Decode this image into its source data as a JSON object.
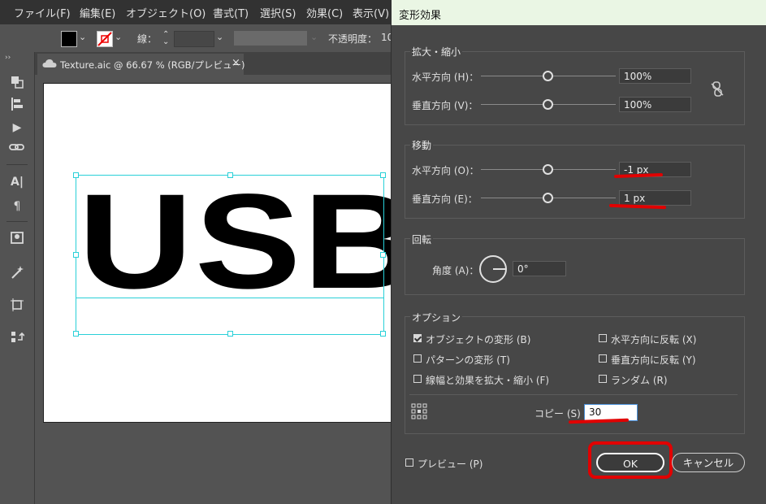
{
  "menubar": {
    "items": [
      "ファイル(F)",
      "編集(E)",
      "オブジェクト(O)",
      "書式(T)",
      "選択(S)",
      "効果(C)",
      "表示(V)"
    ]
  },
  "controlbar": {
    "stroke_label": "線：",
    "opacity_label": "不透明度：",
    "opacity_value": "10"
  },
  "document": {
    "tab_title": "Texture.aic @ 66.67 % (RGB/プレビュー)",
    "close_glyph": "×",
    "artwork_text": "USB"
  },
  "dialog": {
    "title": "変形効果",
    "scale": {
      "group_title": "拡大・縮小",
      "horizontal_label": "水平方向 (H)：",
      "horizontal_value": "100%",
      "vertical_label": "垂直方向 (V)：",
      "vertical_value": "100%"
    },
    "move": {
      "group_title": "移動",
      "horizontal_label": "水平方向 (O)：",
      "horizontal_value": "-1 px",
      "vertical_label": "垂直方向 (E)：",
      "vertical_value": "1 px"
    },
    "rotate": {
      "group_title": "回転",
      "angle_label": "角度 (A)：",
      "angle_value": "0°"
    },
    "options": {
      "group_title": "オプション",
      "transform_objects": "オブジェクトの変形 (B)",
      "transform_objects_checked": true,
      "transform_patterns": "パターンの変形 (T)",
      "scale_strokes": "線幅と効果を拡大・縮小 (F)",
      "reflect_x": "水平方向に反転 (X)",
      "reflect_y": "垂直方向に反転 (Y)",
      "random": "ランダム (R)",
      "copies_label": "コピー (S)",
      "copies_value": "30"
    },
    "preview_label": "プレビュー (P)",
    "ok_label": "OK",
    "cancel_label": "キャンセル"
  },
  "colors": {
    "annotation_red": "#e10000",
    "selection_cyan": "#29d0d8",
    "dialog_bg": "#474747",
    "title_bg": "#eaf6e4"
  }
}
